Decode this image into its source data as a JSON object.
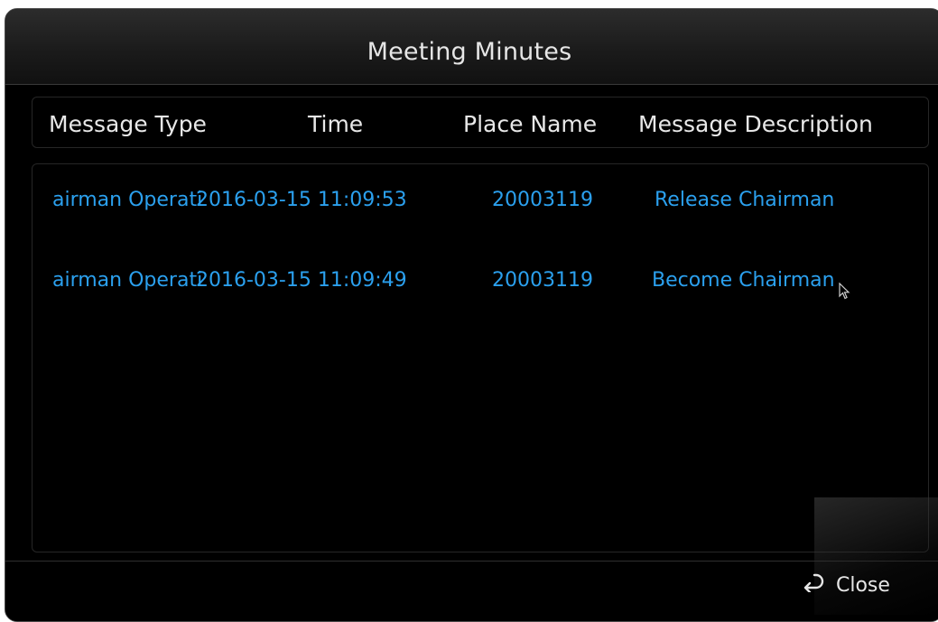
{
  "dialog": {
    "title": "Meeting Minutes"
  },
  "table": {
    "columns": [
      "Message Type",
      "Time",
      "Place Name",
      "Message Description"
    ],
    "rows": [
      {
        "message_type": "airman Operati",
        "time": "2016-03-15 11:09:53",
        "place_name": "20003119",
        "message_description": "Release Chairman"
      },
      {
        "message_type": "airman Operati",
        "time": "2016-03-15 11:09:49",
        "place_name": "20003119",
        "message_description": "Become Chairman"
      }
    ]
  },
  "footer": {
    "close_label": "Close",
    "close_icon": "return-arrow-icon"
  },
  "colors": {
    "background": "#000000",
    "row_text": "#2ba0ee",
    "header_text": "#e8e8e8"
  }
}
